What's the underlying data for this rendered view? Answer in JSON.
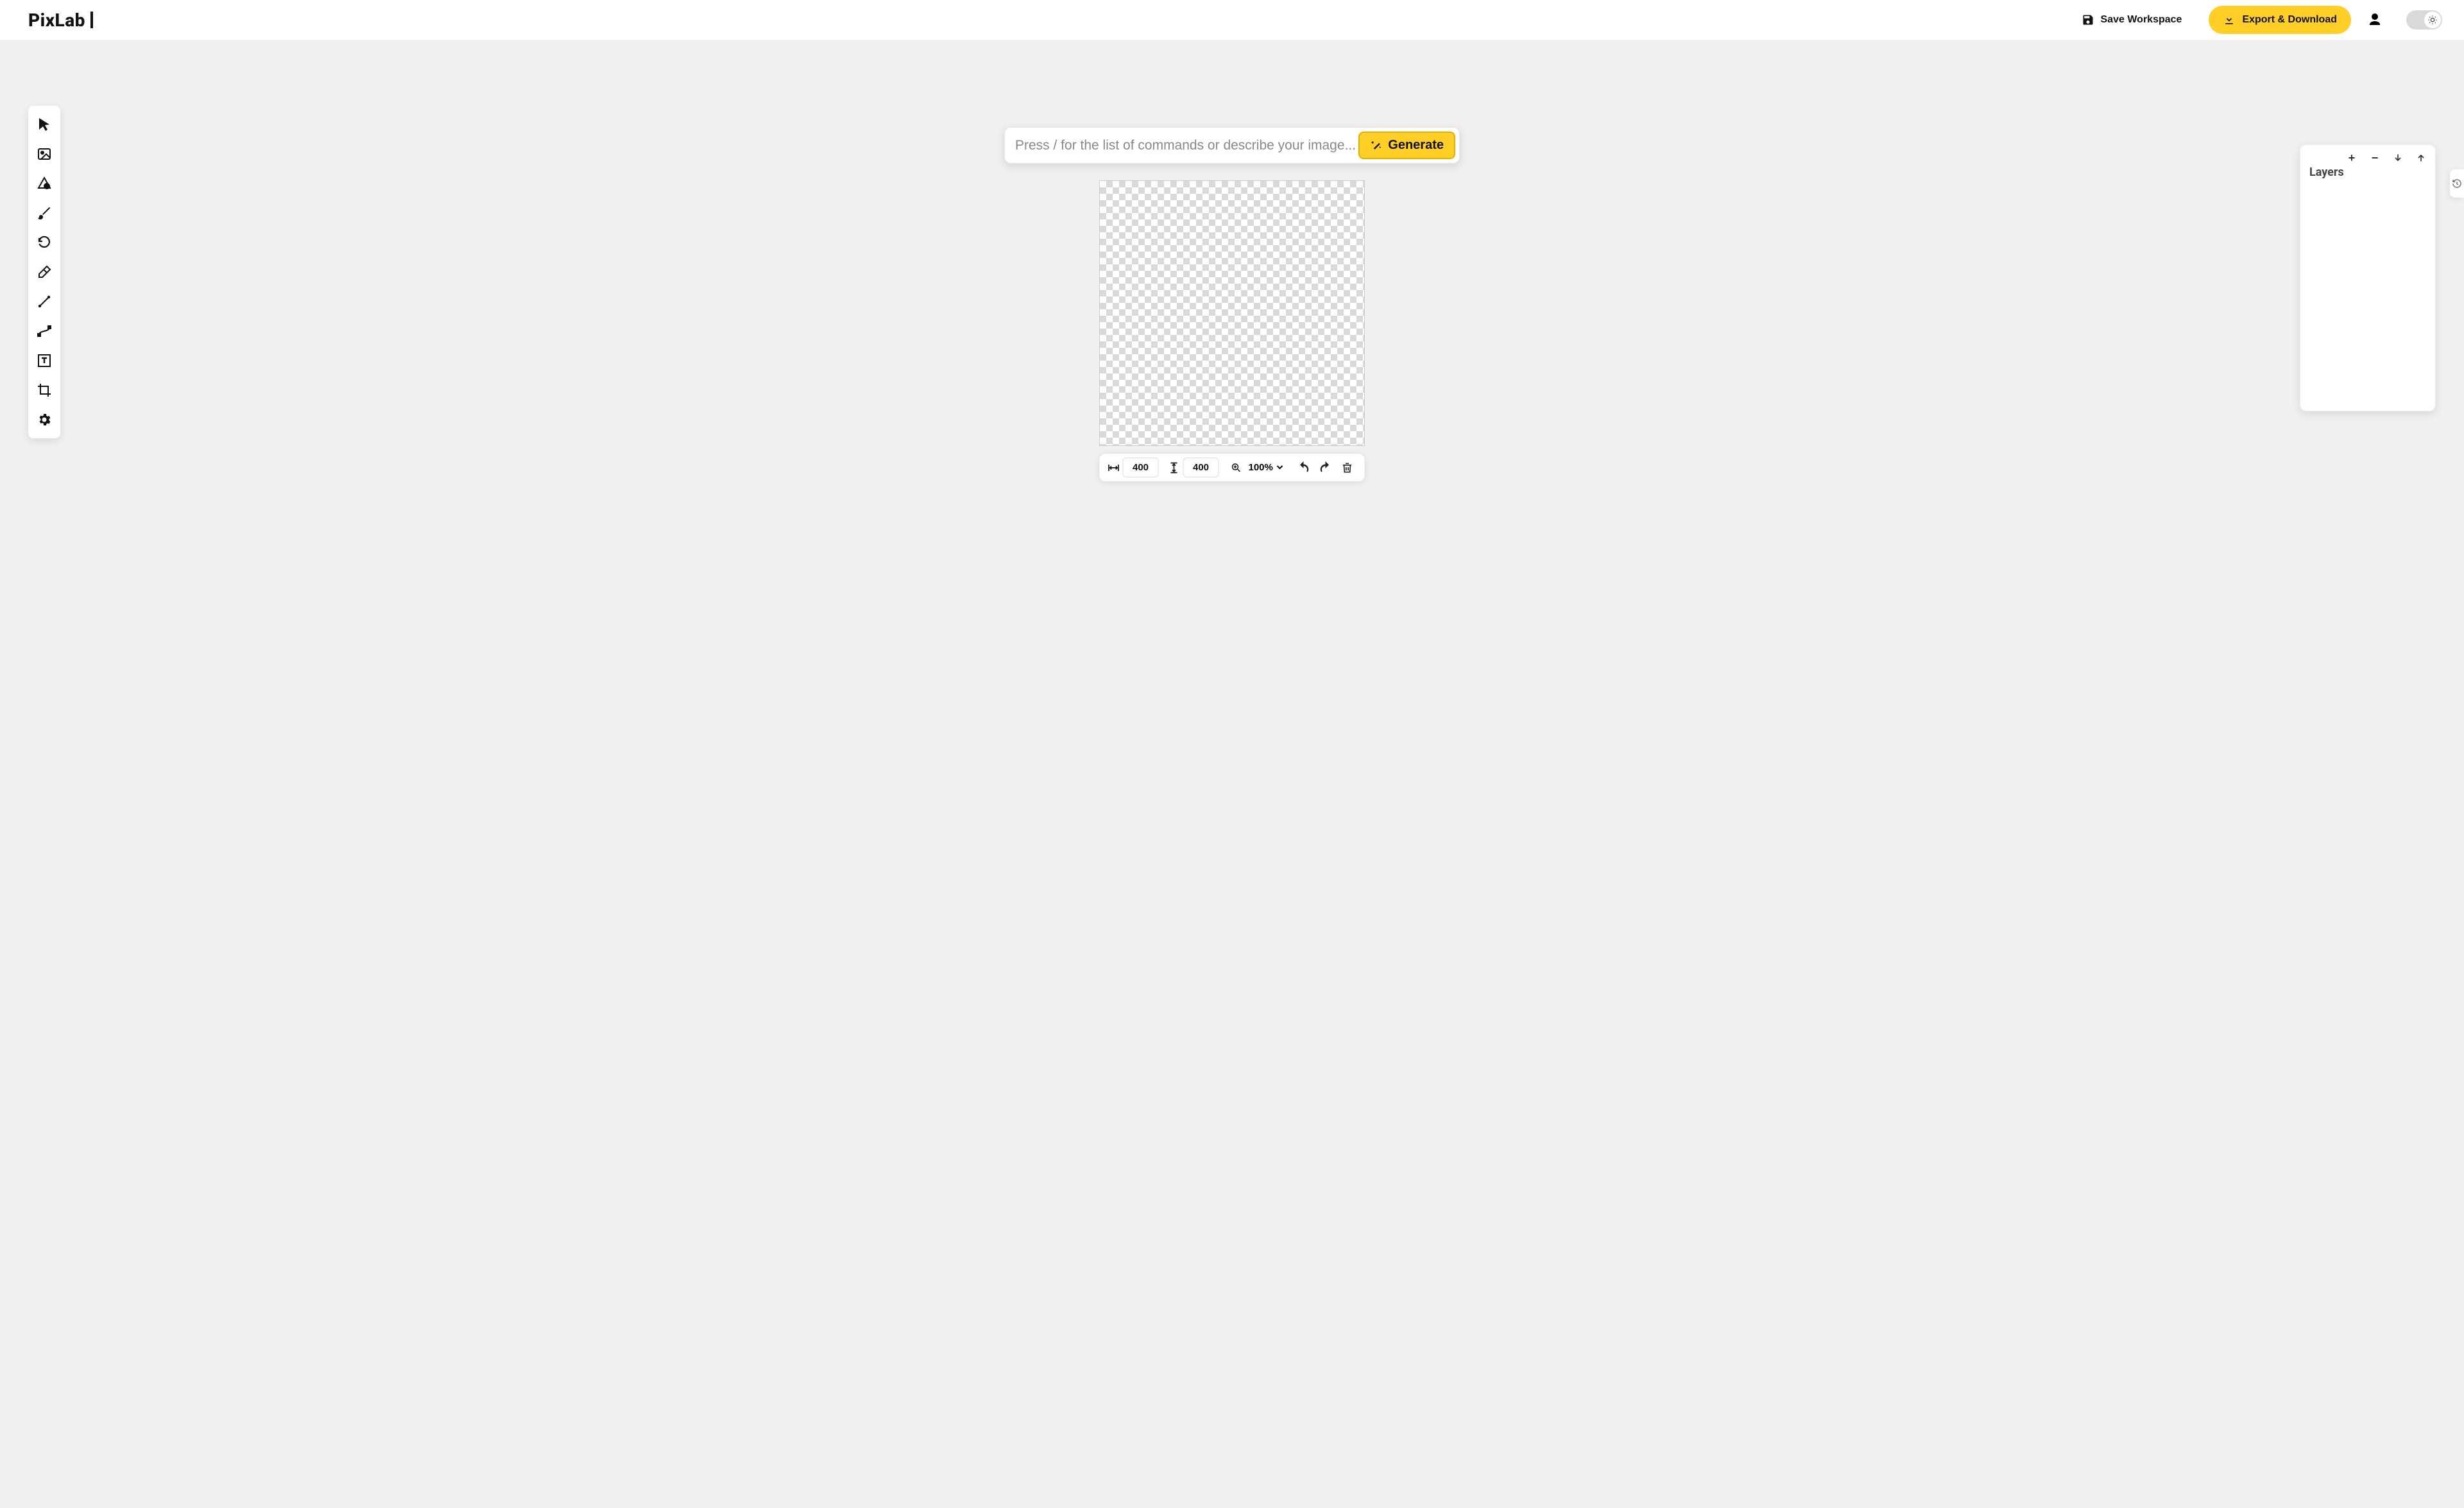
{
  "header": {
    "logo_text": "PixLab",
    "save_label": "Save Workspace",
    "export_label": "Export & Download"
  },
  "prompt": {
    "placeholder": "Press / for the list of commands or describe your image...",
    "generate_label": "Generate"
  },
  "canvas": {
    "width": "400",
    "height": "400",
    "zoom": "100%"
  },
  "layers": {
    "title": "Layers"
  },
  "toolbar_icons": [
    "cursor",
    "image",
    "shape",
    "brush",
    "undo-rotate",
    "eraser",
    "line",
    "bezier",
    "text",
    "crop",
    "settings"
  ]
}
